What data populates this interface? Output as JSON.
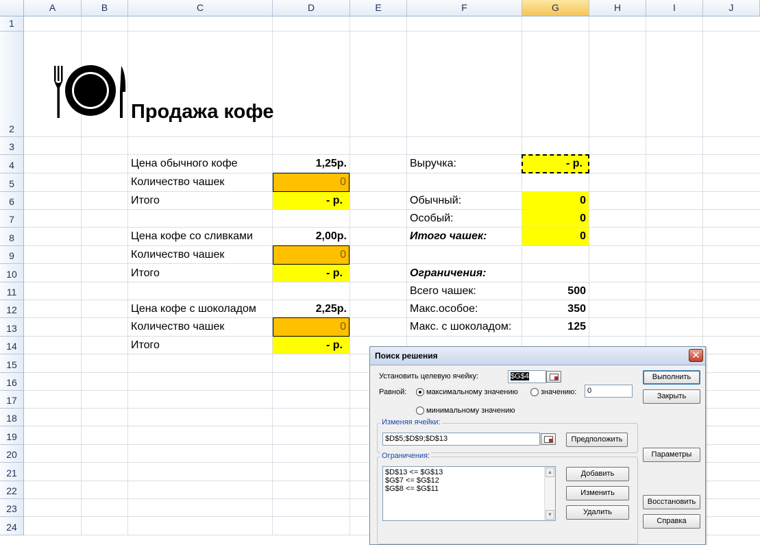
{
  "columns": [
    "A",
    "B",
    "C",
    "D",
    "E",
    "F",
    "G",
    "H",
    "I",
    "J"
  ],
  "rows": [
    "1",
    "2",
    "3",
    "4",
    "5",
    "6",
    "7",
    "8",
    "9",
    "10",
    "11",
    "12",
    "13",
    "14",
    "15",
    "16",
    "17",
    "18",
    "19",
    "20",
    "21",
    "22",
    "23",
    "24"
  ],
  "sheet": {
    "title": "Продажа кофе",
    "c4": "Цена обычного кофе",
    "d4": "1,25р.",
    "c5": "Количество чашек",
    "d5": "0",
    "c6": "Итого",
    "d6": "-    р.",
    "c8": "Цена кофе со сливками",
    "d8": "2,00р.",
    "c9": "Количество чашек",
    "d9": "0",
    "c10": "Итого",
    "d10": "-    р.",
    "c12": "Цена кофе с шоколадом",
    "d12": "2,25р.",
    "c13": "Количество чашек",
    "d13": "0",
    "c14": "Итого",
    "d14": "-    р.",
    "f4": "Выручка:",
    "g4": "-    р.",
    "f6": "Обычный:",
    "g6": "0",
    "f7": "Особый:",
    "g7": "0",
    "f8": "Итого чашек:",
    "g8": "0",
    "f10": "Ограничения:",
    "f11": "Всего чашек:",
    "g11": "500",
    "f12": "Макс.особое:",
    "g12": "350",
    "f13": "Макс. с шоколадом:",
    "g13": "125"
  },
  "solver": {
    "title": "Поиск решения",
    "close": "✕",
    "target_label": "Установить целевую ячейку:",
    "target_value": "$G$4",
    "equal_label": "Равной:",
    "opt_max": "максимальному значению",
    "opt_value": "значению:",
    "value_field": "0",
    "opt_min": "минимальному значению",
    "changing_label": "Изменяя ячейки:",
    "changing_value": "$D$5;$D$9;$D$13",
    "guess_btn": "Предположить",
    "constraints_label": "Ограничения:",
    "constraints": [
      "$D$13 <= $G$13",
      "$G$7 <= $G$12",
      "$G$8 <= $G$11"
    ],
    "add_btn": "Добавить",
    "change_btn": "Изменить",
    "delete_btn": "Удалить",
    "solve_btn": "Выполнить",
    "close_btn": "Закрыть",
    "options_btn": "Параметры",
    "reset_btn": "Восстановить",
    "help_btn": "Справка"
  }
}
